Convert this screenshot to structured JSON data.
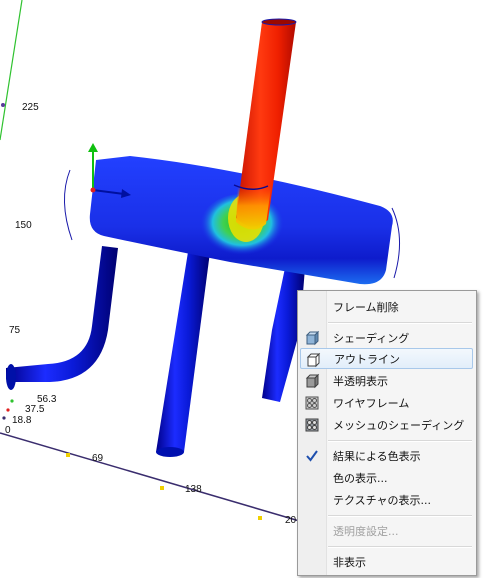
{
  "scene": {
    "axis_ticks_vertical": [
      "225",
      "150",
      "75"
    ],
    "axis_ticks_corner": [
      "56.3",
      "37.5",
      "18.8",
      "0"
    ],
    "axis_ticks_horizontal": [
      "69",
      "138",
      "20"
    ]
  },
  "context_menu": {
    "items": [
      {
        "label": "フレーム削除",
        "icon": "none",
        "enabled": true
      },
      {
        "label": "シェーディング",
        "icon": "shaded-cube-icon",
        "enabled": true
      },
      {
        "label": "アウトライン",
        "icon": "outline-cube-icon",
        "enabled": true,
        "highlighted": true
      },
      {
        "label": "半透明表示",
        "icon": "translucent-cube-icon",
        "enabled": true
      },
      {
        "label": "ワイヤフレーム",
        "icon": "wireframe-icon",
        "enabled": true
      },
      {
        "label": "メッシュのシェーディング",
        "icon": "mesh-shading-icon",
        "enabled": true
      },
      {
        "label": "結果による色表示",
        "icon": "checkmark-icon",
        "enabled": true,
        "checked": true
      },
      {
        "label": "色の表示...",
        "icon": "none",
        "enabled": true
      },
      {
        "label": "テクスチャの表示...",
        "icon": "none",
        "enabled": true
      },
      {
        "label": "透明度設定...",
        "icon": "none",
        "enabled": false
      },
      {
        "label": "非表示",
        "icon": "none",
        "enabled": true
      }
    ]
  },
  "colors": {
    "pipe_blue": "#1010e0",
    "hot_red": "#e82000",
    "menu_highlight": "#cde3f8",
    "axis_line": "#3a2d6e",
    "axis_green": "#2fc22f"
  }
}
